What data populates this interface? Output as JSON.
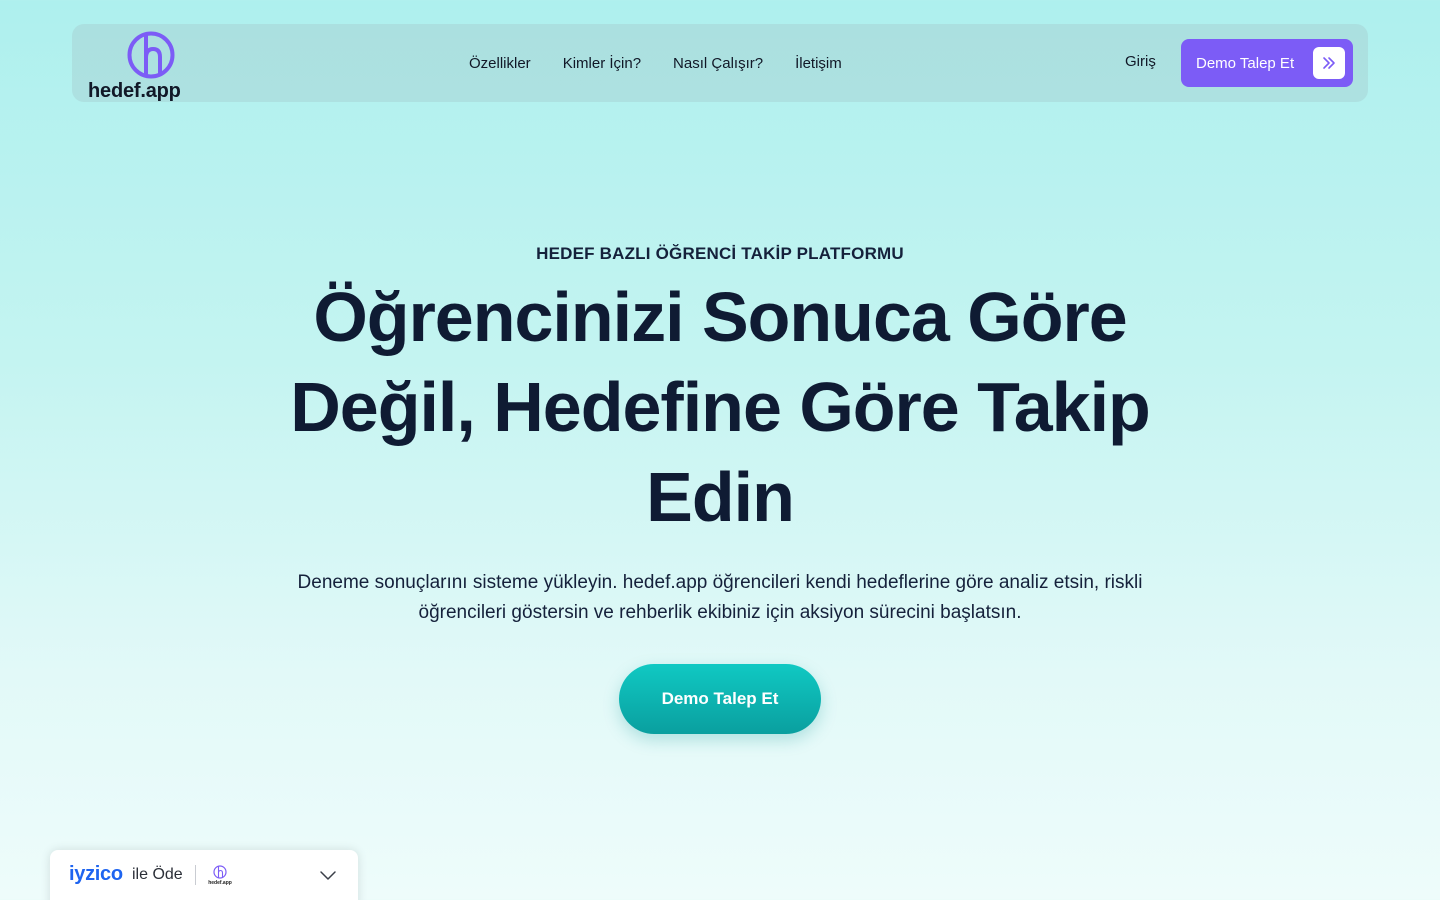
{
  "navbar": {
    "logo_text": "hedef.app",
    "links": [
      "Özellikler",
      "Kimler İçin?",
      "Nasıl Çalışır?",
      "İletişim"
    ],
    "login_label": "Giriş",
    "demo_label": "Demo Talep Et"
  },
  "hero": {
    "eyebrow": "HEDEF BAZLI ÖĞRENCİ TAKİP PLATFORMU",
    "title": "Öğrencinizi Sonuca Göre Değil, Hedefine Göre Takip Edin",
    "description": "Deneme sonuçlarını sisteme yükleyin. hedef.app öğrencileri kendi hedeflerine göre analiz etsin, riskli öğrencileri göstersin ve rehberlik ekibiniz için aksiyon sürecini başlatsın.",
    "cta_label": "Demo Talep Et"
  },
  "payment": {
    "brand": "iyzico",
    "label": "ile Öde",
    "merchant_logo_text": "hedef.app"
  },
  "colors": {
    "accent_purple": "#7c5cf6",
    "cta_teal": "#0fb8b4",
    "text_dark": "#0f1b33",
    "iyzico_blue": "#1e64f0"
  },
  "icons": {
    "nav_demo_icon": "double-chevron-right-icon",
    "payment_toggle_icon": "chevron-down-icon"
  }
}
